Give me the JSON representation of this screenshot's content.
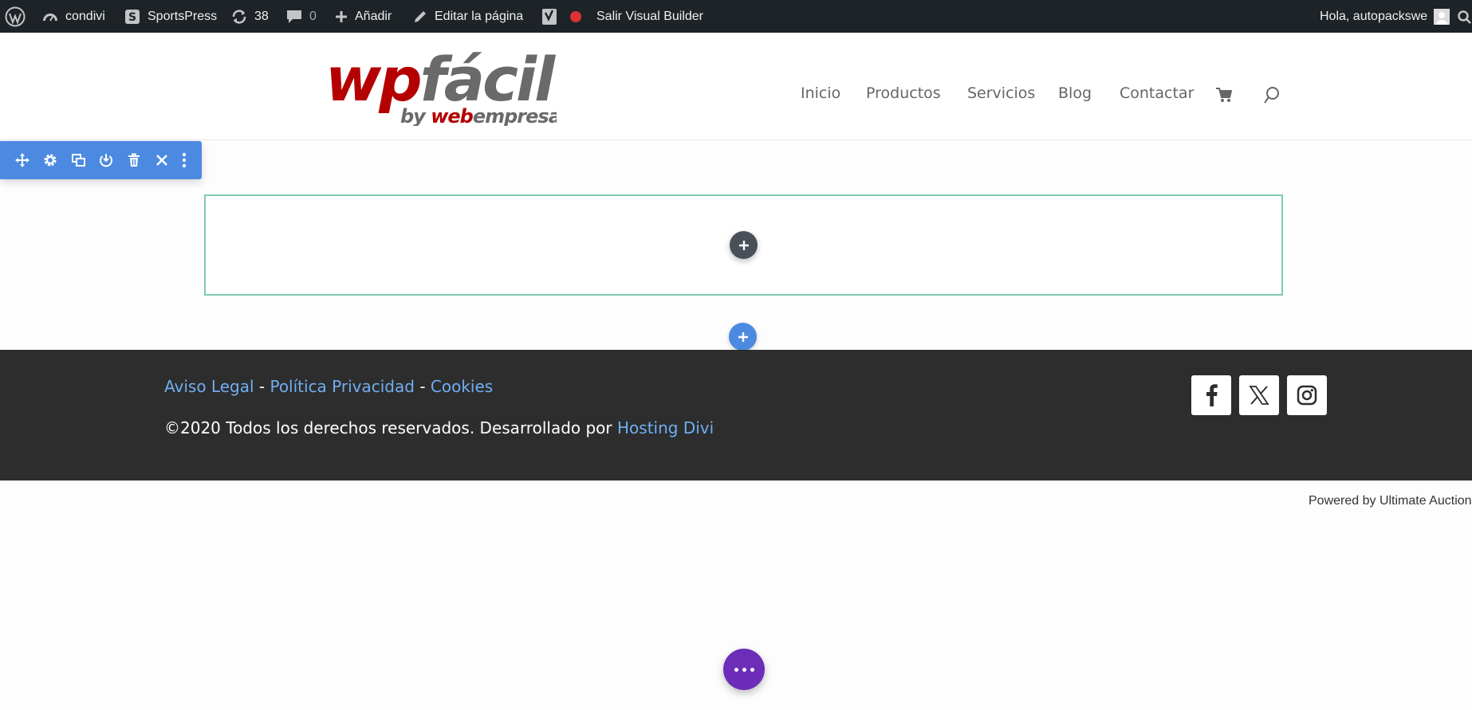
{
  "admin_bar": {
    "site_name": "condivi",
    "sportspress": "SportsPress",
    "updates_count": "38",
    "comments_count": "0",
    "add_new": "Añadir",
    "edit_page": "Editar la página",
    "exit_builder": "Salir Visual Builder",
    "greeting": "Hola, autopackswe",
    "icons": [
      "wordpress-icon",
      "dashboard-icon",
      "sportspress-icon",
      "updates-icon",
      "comments-icon",
      "plus-icon",
      "pencil-icon",
      "yoast-icon",
      "status-dot-icon",
      "avatar",
      "search-icon"
    ]
  },
  "header": {
    "logo": {
      "main_part1": "wp",
      "main_part2": "fácil",
      "by": "by",
      "by_brand_red": "web",
      "by_brand_grey": "empresa"
    },
    "nav": [
      "Inicio",
      "Productos",
      "Servicios",
      "Blog",
      "Contactar"
    ],
    "icons": [
      "cart-icon",
      "search-icon"
    ]
  },
  "builder_toolbar": {
    "icons": [
      "move-icon",
      "settings-icon",
      "duplicate-icon",
      "save-to-library-icon",
      "delete-icon",
      "close-icon",
      "more-icon"
    ]
  },
  "builder": {
    "add_row_symbol": "+",
    "add_section_symbol": "+"
  },
  "footer": {
    "links": [
      "Aviso Legal",
      "Política Privacidad",
      "Cookies"
    ],
    "separator": "-",
    "copyright": "©2020 Todos los derechos reservados. Desarrollado por",
    "credit_link": "Hosting Divi",
    "social": [
      "facebook-icon",
      "x-icon",
      "instagram-icon"
    ]
  },
  "powered_by": "Powered by Ultimate Auction",
  "colors": {
    "admin_bar": "#1d2327",
    "builder_blue": "#4c8ae1",
    "row_outline": "#7dcbb4",
    "footer_bg": "#2d2d2d",
    "footer_link": "#6faef3",
    "fab_purple": "#6c2eb9",
    "logo_red": "#b40000",
    "logo_grey": "#6a6a6a"
  }
}
